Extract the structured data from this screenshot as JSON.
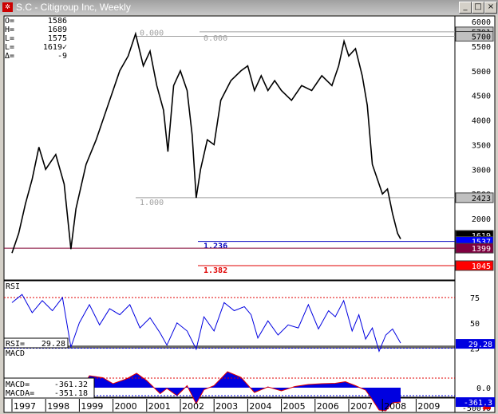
{
  "window": {
    "title": "S.C - Citigroup Inc, Weekly",
    "icon": "chart-app-icon",
    "minimize": "_",
    "maximize": "□",
    "close": "×"
  },
  "ohlc": [
    {
      "k": "O=",
      "v": "1586"
    },
    {
      "k": "H=",
      "v": "1689"
    },
    {
      "k": "L=",
      "v": "1575"
    },
    {
      "k": "L=",
      "v": "1619✓"
    },
    {
      "k": "Δ=",
      "v": "-9"
    }
  ],
  "chart_data": [
    {
      "type": "line",
      "title": "S.C - Citigroup Inc, Weekly",
      "xlim": [
        1997,
        2009.8
      ],
      "ylim": [
        900,
        6100
      ],
      "y_ticks": [
        "6000",
        "5500",
        "5000",
        "4500",
        "4000",
        "3500",
        "3000",
        "2500",
        "2000"
      ],
      "x_ticks": [
        "1997",
        "1998",
        "1999",
        "2000",
        "2001",
        "2002",
        "2003",
        "2004",
        "2005",
        "2006",
        "2007",
        "2008",
        "2009"
      ],
      "series": [
        {
          "x": [
            1997.0,
            1997.2,
            1997.4,
            1997.6,
            1997.8,
            1998.0,
            1998.3,
            1998.55,
            1998.75,
            1998.9,
            1999.2,
            1999.5,
            1999.8,
            2000.0,
            2000.2,
            2000.45,
            2000.67,
            2000.9,
            2001.1,
            2001.3,
            2001.5,
            2001.63,
            2001.8,
            2002.0,
            2002.2,
            2002.35,
            2002.47,
            2002.6,
            2002.8,
            2003.0,
            2003.2,
            2003.5,
            2003.8,
            2004.0,
            2004.2,
            2004.4,
            2004.6,
            2004.8,
            2005.0,
            2005.3,
            2005.6,
            2005.9,
            2006.2,
            2006.5,
            2006.7,
            2006.86,
            2007.0,
            2007.2,
            2007.4,
            2007.55,
            2007.7,
            2007.85,
            2008.0,
            2008.15,
            2008.3,
            2008.45,
            2008.54
          ],
          "y": [
            1300,
            1700,
            2300,
            2800,
            3450,
            3000,
            3300,
            2700,
            1380,
            2200,
            3100,
            3600,
            4200,
            4600,
            5000,
            5300,
            5750,
            5100,
            5400,
            4700,
            4200,
            3360,
            4700,
            5000,
            4600,
            3700,
            2420,
            3000,
            3600,
            3500,
            4400,
            4800,
            5000,
            5100,
            4600,
            4900,
            4600,
            4800,
            4600,
            4400,
            4700,
            4600,
            4900,
            4700,
            5100,
            5600,
            5300,
            5450,
            4900,
            4300,
            3100,
            2800,
            2500,
            2600,
            2100,
            1700,
            1586
          ]
        }
      ],
      "fib_levels": [
        {
          "ratio": "0.000",
          "value": 5700
        },
        {
          "ratio": "0.000",
          "value": 5791
        },
        {
          "ratio": "1.000",
          "value": 2423
        },
        {
          "ratio": "1.236",
          "value": 1537
        },
        {
          "ratio": "1.382",
          "value": 1045
        }
      ],
      "support_line": 1399,
      "price_tags": [
        {
          "text": "5791",
          "value": 5791,
          "bg": "#c0c0c0",
          "fg": "#000"
        },
        {
          "text": "5700",
          "value": 5700,
          "bg": "#c0c0c0",
          "fg": "#000"
        },
        {
          "text": "2423",
          "value": 2423,
          "bg": "#c0c0c0",
          "fg": "#000"
        },
        {
          "text": "1619",
          "value": 1660,
          "bg": "#000000",
          "fg": "#fff"
        },
        {
          "text": "1537",
          "value": 1537,
          "bg": "#0000ff",
          "fg": "#fff"
        },
        {
          "text": "1399",
          "value": 1399,
          "bg": "#800040",
          "fg": "#fff"
        },
        {
          "text": "1045",
          "value": 1045,
          "bg": "#ff0000",
          "fg": "#fff"
        }
      ]
    },
    {
      "type": "line",
      "title": "RSI",
      "ylim": [
        15,
        85
      ],
      "y_ticks": [
        "75",
        "50",
        "25"
      ],
      "overbought": 75,
      "oversold": 25,
      "current_label": "RSI=",
      "current": "29.28",
      "tag": "29.28",
      "x": [
        1997.0,
        1997.3,
        1997.6,
        1997.9,
        1998.2,
        1998.5,
        1998.75,
        1999.0,
        1999.3,
        1999.6,
        1999.9,
        2000.2,
        2000.5,
        2000.8,
        2001.1,
        2001.4,
        2001.6,
        2001.9,
        2002.2,
        2002.47,
        2002.7,
        2003.0,
        2003.3,
        2003.6,
        2003.9,
        2004.1,
        2004.3,
        2004.6,
        2004.9,
        2005.2,
        2005.5,
        2005.8,
        2006.1,
        2006.4,
        2006.6,
        2006.85,
        2007.1,
        2007.3,
        2007.5,
        2007.7,
        2007.9,
        2008.1,
        2008.3,
        2008.54
      ],
      "y": [
        70,
        78,
        60,
        72,
        62,
        75,
        26,
        50,
        68,
        48,
        64,
        58,
        68,
        45,
        55,
        40,
        28,
        50,
        42,
        24,
        56,
        42,
        70,
        62,
        66,
        58,
        35,
        52,
        38,
        48,
        45,
        68,
        44,
        62,
        56,
        72,
        42,
        58,
        34,
        45,
        22,
        38,
        44,
        30
      ]
    },
    {
      "type": "area",
      "title": "MACD",
      "ylim": [
        -700,
        500
      ],
      "y_ticks": [
        "0.0",
        "-500.0"
      ],
      "upper": 240,
      "lower": -200,
      "macd_label": "MACD=",
      "macd": "-361.32",
      "macda_label": "MACDA=",
      "macda": "-351.18",
      "tag": "-361.3",
      "x": [
        1997.0,
        1997.5,
        1998.0,
        1998.4,
        1998.7,
        1998.9,
        1999.3,
        1999.7,
        2000.0,
        2000.4,
        2000.7,
        2001.0,
        2001.4,
        2001.6,
        2001.9,
        2002.2,
        2002.47,
        2002.7,
        2003.0,
        2003.4,
        2003.8,
        2004.2,
        2004.6,
        2005.0,
        2005.4,
        2005.8,
        2006.2,
        2006.6,
        2006.9,
        2007.2,
        2007.5,
        2007.7,
        2007.9,
        2008.1,
        2008.3,
        2008.54
      ],
      "y": [
        130,
        190,
        190,
        230,
        -20,
        -250,
        300,
        250,
        100,
        220,
        360,
        180,
        -150,
        -20,
        -200,
        50,
        -400,
        -50,
        50,
        400,
        260,
        -120,
        20,
        -80,
        30,
        80,
        100,
        110,
        150,
        50,
        -60,
        -300,
        -560,
        -580,
        -380,
        -361
      ]
    }
  ]
}
